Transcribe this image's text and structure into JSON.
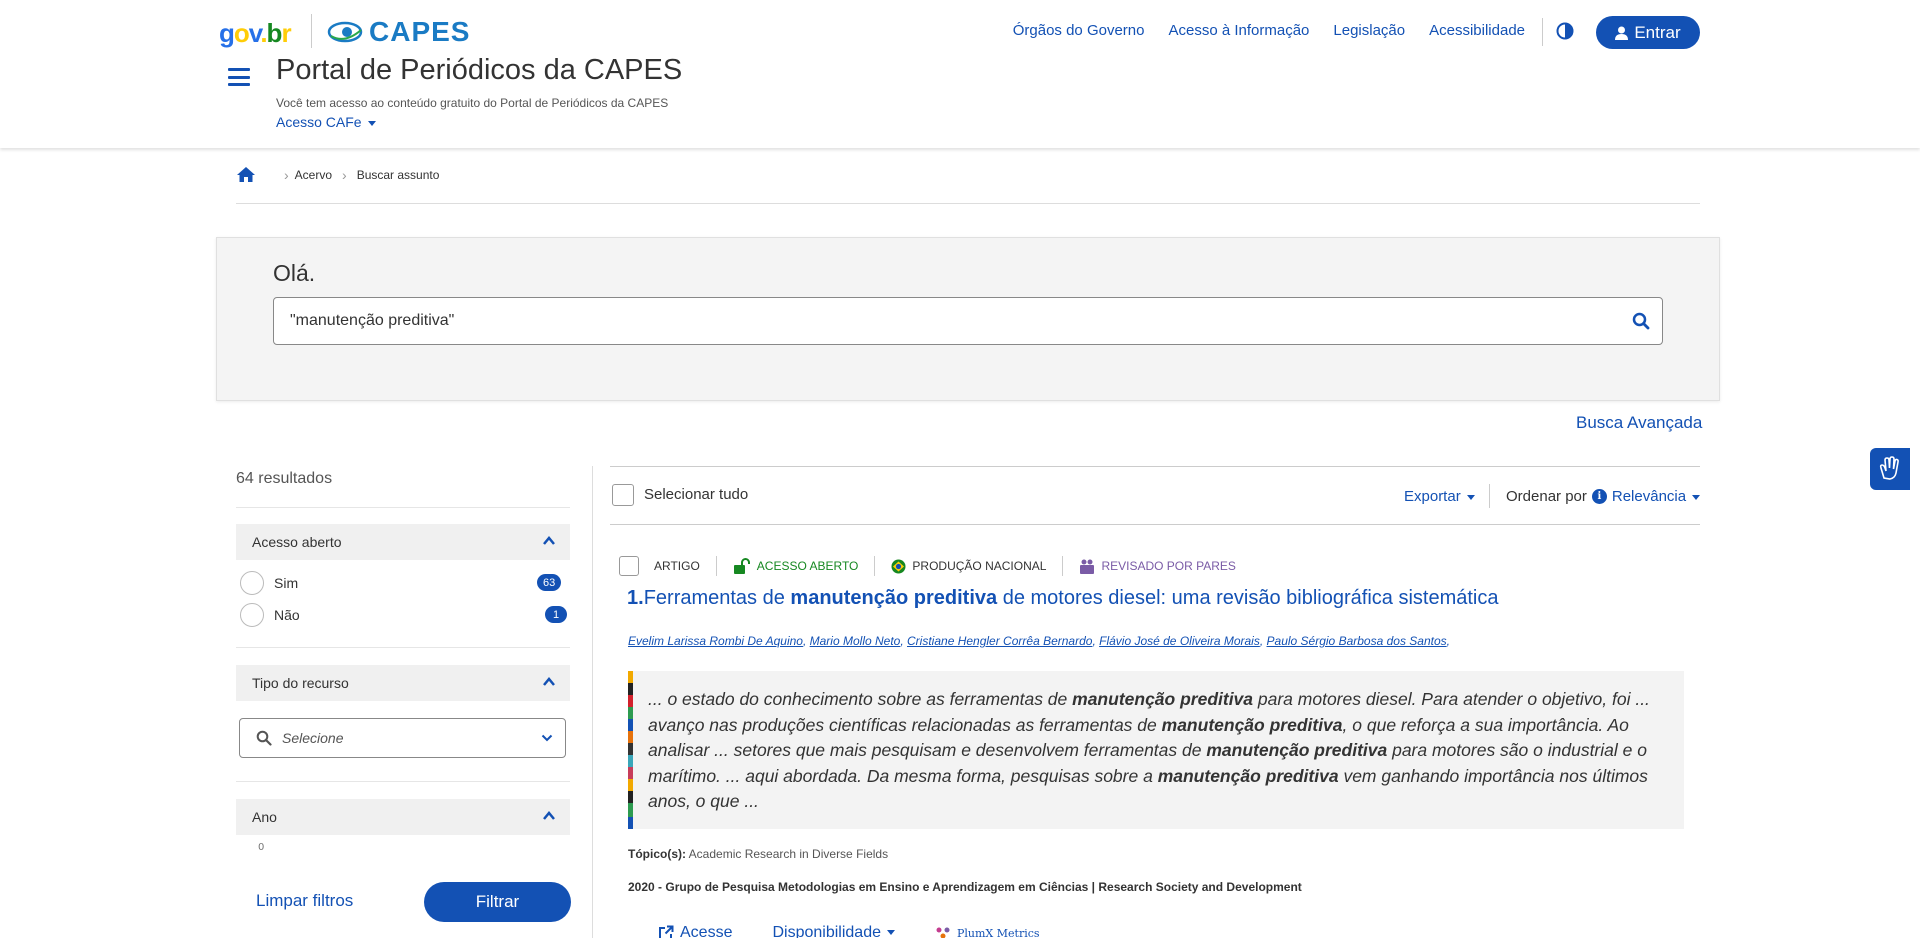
{
  "header": {
    "govbr_logo": {
      "g": "g",
      "o": "o",
      "v": "v",
      "dot": ".",
      "b": "b",
      "r": "r"
    },
    "capes_logo": "CAPES",
    "nav": [
      "Órgãos do Governo",
      "Acesso à Informação",
      "Legislação",
      "Acessibilidade"
    ],
    "login_label": "Entrar",
    "portal_title": "Portal de Periódicos da CAPES",
    "portal_subtitle": "Você tem acesso ao conteúdo gratuito do Portal de Periódicos da CAPES",
    "cafe_label": "Acesso CAFe"
  },
  "breadcrumb": {
    "items": [
      "Acervo",
      "Buscar assunto"
    ]
  },
  "search": {
    "greeting": "Olá.",
    "query": "\"manutenção preditiva\"",
    "advanced_label": "Busca Avançada"
  },
  "sidebar": {
    "results_count": "64 resultados",
    "facets": [
      {
        "title": "Acesso aberto",
        "options": [
          {
            "label": "Sim",
            "count": "63"
          },
          {
            "label": "Não",
            "count": "1"
          }
        ]
      },
      {
        "title": "Tipo do recurso",
        "placeholder": "Selecione"
      },
      {
        "title": "Ano",
        "peek": "0"
      }
    ],
    "clear_label": "Limpar filtros",
    "filter_label": "Filtrar"
  },
  "toolbar": {
    "select_all": "Selecionar tudo",
    "export": "Exportar",
    "sort_label": "Ordenar por",
    "sort_value": "Relevância"
  },
  "results": [
    {
      "tags": {
        "type": "ARTIGO",
        "open": "ACESSO ABERTO",
        "national": "PRODUÇÃO NACIONAL",
        "peer": "REVISADO POR PARES"
      },
      "number": "1.",
      "title_pre": "Ferramentas de ",
      "title_bold": "manutenção preditiva",
      "title_post": " de motores diesel: uma revisão bibliográfica sistemática",
      "authors": [
        "Evelim Larissa Rombi De Aquino",
        "Mario Mollo Neto",
        "Cristiane Hengler Corrêa Bernardo",
        "Flávio José de Oliveira Morais",
        "Paulo Sérgio Barbosa dos Santos"
      ],
      "abstract": {
        "p1": "... o estado do conhecimento sobre as ferramentas de ",
        "b1": "manutenção preditiva",
        "p2": " para motores diesel. Para atender o objetivo, foi ... avanço nas produções científicas relacionadas as ferramentas de ",
        "b2": "manutenção preditiva",
        "p3": ", o que reforça a sua importância. Ao analisar ... setores que mais pesquisam e desenvolvem ferramentas de ",
        "b3": "manutenção preditiva",
        "p4": " para motores são o industrial e o marítimo. ... aqui abordada. Da mesma forma, pesquisas sobre a ",
        "b4": "manutenção preditiva",
        "p5": " vem ganhando importância nos últimos anos, o que ..."
      },
      "topics_label": "Tópico(s):",
      "topics": " Academic Research in Diverse Fields",
      "pubinfo": "2020 - Grupo de Pesquisa Metodologias em Ensino e Aprendizagem em Ciências | Research Society and Development",
      "actions": {
        "access": "Acesse",
        "availability": "Disponibilidade",
        "plumx": "PlumX Metrics"
      }
    }
  ],
  "colors": {
    "primary": "#1351b4",
    "open_access": "#168821",
    "peer_review": "#7a5ba6"
  }
}
